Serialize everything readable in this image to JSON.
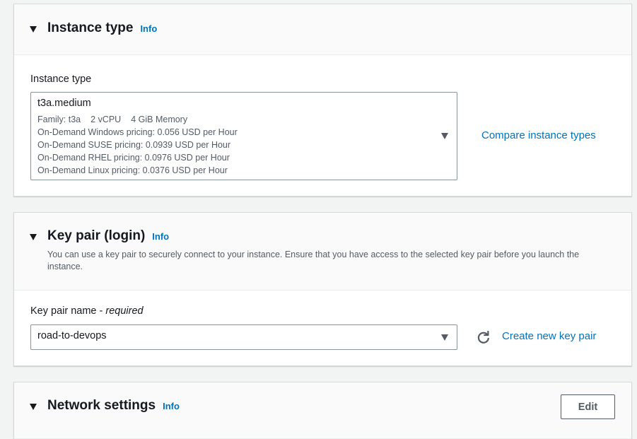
{
  "instance_type_section": {
    "title": "Instance type",
    "info": "Info",
    "field_label": "Instance type",
    "selected_value": "t3a.medium",
    "family": "Family: t3a",
    "vcpu": "2 vCPU",
    "memory": "4 GiB Memory",
    "pricing": [
      "On-Demand Windows pricing: 0.056 USD per Hour",
      "On-Demand SUSE pricing: 0.0939 USD per Hour",
      "On-Demand RHEL pricing: 0.0976 USD per Hour",
      "On-Demand Linux pricing: 0.0376 USD per Hour"
    ],
    "compare_link": "Compare instance types"
  },
  "key_pair_section": {
    "title": "Key pair (login)",
    "info": "Info",
    "description": "You can use a key pair to securely connect to your instance. Ensure that you have access to the selected key pair before you launch the instance.",
    "field_label": "Key pair name - ",
    "field_required": "required",
    "selected_value": "road-to-devops",
    "create_link": "Create new key pair"
  },
  "network_section": {
    "title": "Network settings",
    "info": "Info",
    "edit_button": "Edit"
  },
  "icons": {
    "section_toggle": "caret-down-icon",
    "select_dropdown": "chevron-down-icon",
    "refresh": "refresh-icon"
  },
  "colors": {
    "link": "#0073bb",
    "text": "#16191f",
    "secondary_text": "#545b64",
    "background": "#f2f3f3",
    "panel_header": "#fafafa"
  }
}
